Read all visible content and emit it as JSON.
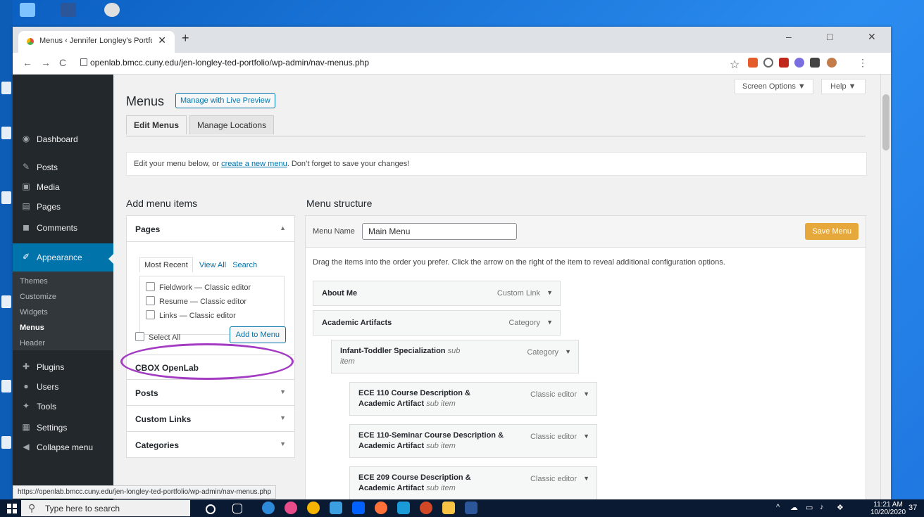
{
  "browser": {
    "tab_title": "Menus ‹ Jennifer Longley's Portfolio",
    "tab_close": "✕",
    "new_tab": "+",
    "url": "openlab.bmcc.cuny.edu/jen-longley-ted-portfolio/wp-admin/nav-menus.php",
    "nav": {
      "back": "←",
      "forward": "→",
      "reload": "C"
    },
    "window": {
      "minimize": "–",
      "maximize": "□",
      "close": "✕"
    },
    "status_url": "https://openlab.bmcc.cuny.edu/jen-longley-ted-portfolio/wp-admin/nav-menus.php"
  },
  "sidebar": {
    "items": [
      {
        "label": "Dashboard",
        "icon": "dashboard-icon"
      },
      {
        "label": "Posts",
        "icon": "pin-icon"
      },
      {
        "label": "Media",
        "icon": "media-icon"
      },
      {
        "label": "Pages",
        "icon": "page-icon"
      },
      {
        "label": "Comments",
        "icon": "comment-icon"
      },
      {
        "label": "Appearance",
        "icon": "brush-icon"
      },
      {
        "label": "Plugins",
        "icon": "plugin-icon"
      },
      {
        "label": "Users",
        "icon": "users-icon"
      },
      {
        "label": "Tools",
        "icon": "wrench-icon"
      },
      {
        "label": "Settings",
        "icon": "settings-icon"
      },
      {
        "label": "Collapse menu",
        "icon": "collapse-icon"
      }
    ],
    "submenu": [
      "Themes",
      "Customize",
      "Widgets",
      "Menus",
      "Header"
    ]
  },
  "header": {
    "title": "Menus",
    "live_preview": "Manage with Live Preview",
    "screen_options": "Screen Options ▼",
    "help": "Help ▼",
    "tabs": [
      "Edit Menus",
      "Manage Locations"
    ]
  },
  "notice": {
    "before": "Edit your menu below, or",
    "link": "create a new menu",
    "after": ". Don’t forget to save your changes!"
  },
  "add_items": {
    "heading": "Add menu items",
    "pages_title": "Pages",
    "subtabs": [
      "Most Recent",
      "View All",
      "Search"
    ],
    "pages": [
      "Fieldwork — Classic editor",
      "Resume — Classic editor",
      "Links — Classic editor"
    ],
    "select_all": "Select All",
    "add_button": "Add to Menu",
    "sections": [
      "CBOX OpenLab",
      "Posts",
      "Custom Links",
      "Categories"
    ]
  },
  "menu_structure": {
    "heading": "Menu structure",
    "name_label": "Menu Name",
    "name_value": "Main Menu",
    "save_button": "Save Menu",
    "hint": "Drag the items into the order you prefer. Click the arrow on the right of the item to reveal additional configuration options.",
    "items": [
      {
        "title": "About Me",
        "sub": "",
        "type": "Custom Link"
      },
      {
        "title": "Academic Artifacts",
        "sub": "",
        "type": "Category"
      },
      {
        "title": "Infant-Toddler Specialization",
        "sub": "sub item",
        "type": "Category"
      },
      {
        "title": "ECE 110 Course Description & Academic Artifact",
        "sub": "sub item",
        "type": "Classic editor"
      },
      {
        "title": "ECE 110-Seminar Course Description & Academic Artifact",
        "sub": "sub item",
        "type": "Classic editor"
      },
      {
        "title": "ECE 209 Course Description & Academic Artifact",
        "sub": "sub item",
        "type": "Classic editor"
      }
    ]
  },
  "taskbar": {
    "search_placeholder": "Type here to search",
    "time": "11:21 AM",
    "date": "10/20/2020",
    "notifications": "37"
  },
  "colors": {
    "accent": "#0073aa",
    "save": "#e6a83a",
    "highlight": "#a43cc3"
  }
}
